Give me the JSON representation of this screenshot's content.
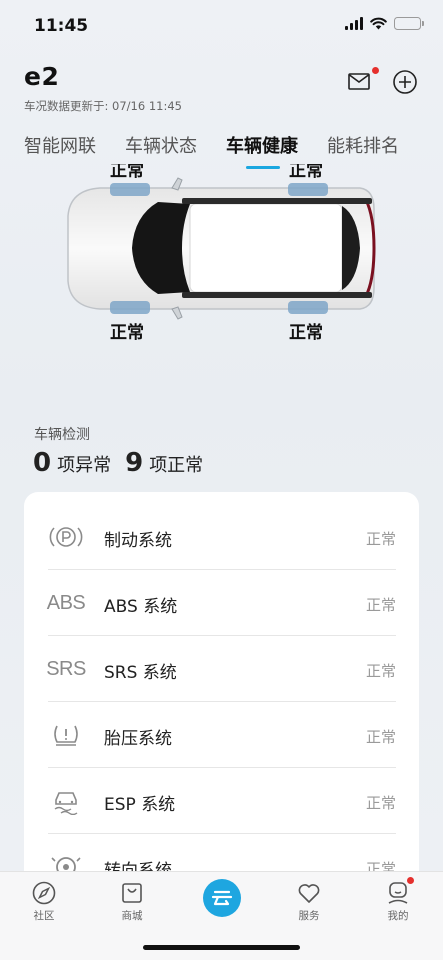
{
  "status_bar": {
    "time": "11:45"
  },
  "header": {
    "title": "e2",
    "subtitle": "车况数据更新于: 07/16 11:45"
  },
  "tabs": [
    {
      "label": "智能网联",
      "active": false
    },
    {
      "label": "车辆状态",
      "active": false
    },
    {
      "label": "车辆健康",
      "active": true
    },
    {
      "label": "能耗排名",
      "active": false
    }
  ],
  "tires": {
    "front_left": "正常",
    "rear_left": "正常",
    "front_right": "正常",
    "rear_right": "正常"
  },
  "inspection": {
    "label": "车辆检测",
    "abnormal_count": "0",
    "abnormal_label": "项异常",
    "normal_count": "9",
    "normal_label": "项正常"
  },
  "systems": [
    {
      "icon": "parking-brake-icon",
      "name": "制动系统",
      "status": "正常"
    },
    {
      "icon": "abs-icon",
      "icon_text": "ABS",
      "name": "ABS 系统",
      "status": "正常"
    },
    {
      "icon": "srs-icon",
      "icon_text": "SRS",
      "name": "SRS 系统",
      "status": "正常"
    },
    {
      "icon": "tire-pressure-icon",
      "name": "胎压系统",
      "status": "正常"
    },
    {
      "icon": "esp-icon",
      "name": "ESP 系统",
      "status": "正常"
    },
    {
      "icon": "steering-icon",
      "name": "转向系统",
      "status": "正常"
    }
  ],
  "tabbar": [
    {
      "icon": "compass-icon",
      "label": "社区"
    },
    {
      "icon": "shopping-bag-icon",
      "label": "商城"
    },
    {
      "icon": "home-logo-icon",
      "label": ""
    },
    {
      "icon": "heart-icon",
      "label": "服务"
    },
    {
      "icon": "profile-icon",
      "label": "我的"
    }
  ],
  "colors": {
    "accent": "#1aa7e0",
    "badge": "#e5302d",
    "battery": "#f4c430"
  }
}
